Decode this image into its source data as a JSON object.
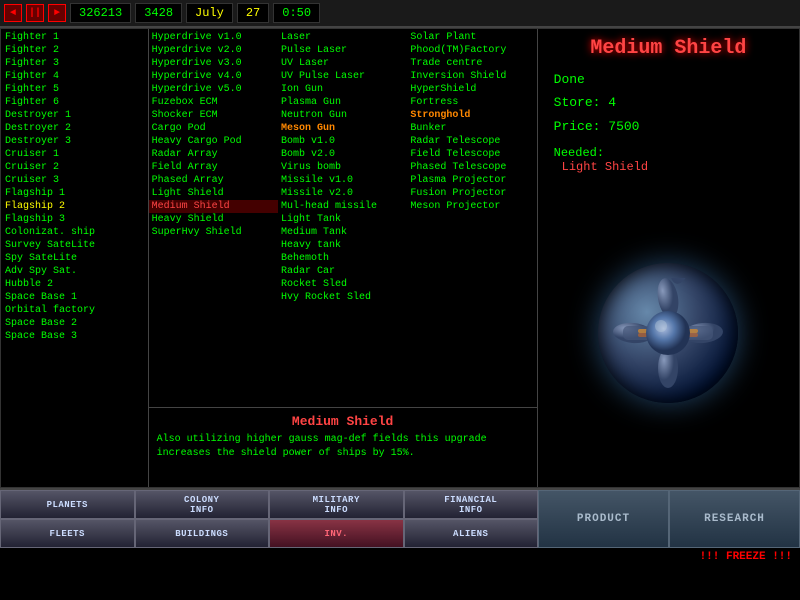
{
  "topbar": {
    "btn1": "◄",
    "btn2": "►",
    "money": "326213",
    "production": "3428",
    "month": "July",
    "day": "27",
    "time": "0:50"
  },
  "ships": [
    {
      "id": 1,
      "name": "Fighter 1"
    },
    {
      "id": 2,
      "name": "Fighter 2"
    },
    {
      "id": 3,
      "name": "Fighter 3"
    },
    {
      "id": 4,
      "name": "Fighter 4"
    },
    {
      "id": 5,
      "name": "Fighter 5"
    },
    {
      "id": 6,
      "name": "Fighter 6"
    },
    {
      "id": 7,
      "name": "Destroyer 1"
    },
    {
      "id": 8,
      "name": "Destroyer 2"
    },
    {
      "id": 9,
      "name": "Destroyer 3"
    },
    {
      "id": 10,
      "name": "Cruiser 1"
    },
    {
      "id": 11,
      "name": "Cruiser 2"
    },
    {
      "id": 12,
      "name": "Cruiser 3"
    },
    {
      "id": 13,
      "name": "Flagship 1"
    },
    {
      "id": 14,
      "name": "Flagship 2"
    },
    {
      "id": 15,
      "name": "Flagship 3"
    },
    {
      "id": 16,
      "name": "Colonizat. ship"
    },
    {
      "id": 17,
      "name": "Survey SateLite"
    },
    {
      "id": 18,
      "name": "Spy SateLite"
    },
    {
      "id": 19,
      "name": "Adv Spy Sat."
    },
    {
      "id": 20,
      "name": "Hubble 2"
    },
    {
      "id": 21,
      "name": "Space Base 1"
    },
    {
      "id": 22,
      "name": "Orbital factory"
    },
    {
      "id": 23,
      "name": "Space Base 2"
    },
    {
      "id": 24,
      "name": "Space Base 3"
    }
  ],
  "tech_col1": [
    {
      "name": "Hyperdrive v1.0",
      "selected": false
    },
    {
      "name": "Hyperdrive v2.0",
      "selected": false
    },
    {
      "name": "Hyperdrive v3.0",
      "selected": false
    },
    {
      "name": "Hyperdrive v4.0",
      "selected": false
    },
    {
      "name": "Hyperdrive v5.0",
      "selected": false
    },
    {
      "name": "Fuzebox ECM",
      "selected": false
    },
    {
      "name": "Shocker ECM",
      "selected": false
    },
    {
      "name": "Cargo Pod",
      "selected": false
    },
    {
      "name": "Heavy Cargo Pod",
      "selected": false
    },
    {
      "name": "Radar Array",
      "selected": false
    },
    {
      "name": "Field Array",
      "selected": false
    },
    {
      "name": "Phased Array",
      "selected": false
    },
    {
      "name": "Light Shield",
      "selected": false
    },
    {
      "name": "Medium Shield",
      "selected": true
    },
    {
      "name": "Heavy Shield",
      "selected": false
    },
    {
      "name": "SuperHvy Shield",
      "selected": false
    }
  ],
  "tech_col2": [
    {
      "name": "Laser",
      "selected": false
    },
    {
      "name": "Pulse Laser",
      "selected": false
    },
    {
      "name": "UV Laser",
      "selected": false
    },
    {
      "name": "UV Pulse Laser",
      "selected": false
    },
    {
      "name": "Ion Gun",
      "selected": false
    },
    {
      "name": "Plasma Gun",
      "selected": false
    },
    {
      "name": "Neutron Gun",
      "selected": false
    },
    {
      "name": "Meson Gun",
      "selected": false,
      "highlight": true
    },
    {
      "name": "Bomb v1.0",
      "selected": false
    },
    {
      "name": "Bomb v2.0",
      "selected": false
    },
    {
      "name": "Virus bomb",
      "selected": false
    },
    {
      "name": "Missile v1.0",
      "selected": false
    },
    {
      "name": "Missile v2.0",
      "selected": false
    },
    {
      "name": "Mul-head missile",
      "selected": false
    },
    {
      "name": "Light Tank",
      "selected": false
    },
    {
      "name": "Medium Tank",
      "selected": false
    },
    {
      "name": "Heavy tank",
      "selected": false
    },
    {
      "name": "Behemoth",
      "selected": false
    },
    {
      "name": "Radar Car",
      "selected": false
    },
    {
      "name": "Rocket Sled",
      "selected": false
    },
    {
      "name": "Hvy Rocket Sled",
      "selected": false
    }
  ],
  "tech_col3": [
    {
      "name": "Solar Plant",
      "selected": false
    },
    {
      "name": "Phood(TM)Factory",
      "selected": false
    },
    {
      "name": "Trade centre",
      "selected": false
    },
    {
      "name": "Inversion Shield",
      "selected": false
    },
    {
      "name": "HyperShield",
      "selected": false
    },
    {
      "name": "Fortress",
      "selected": false
    },
    {
      "name": "Stronghold",
      "selected": false,
      "bold": true
    },
    {
      "name": "Bunker",
      "selected": false
    },
    {
      "name": "Radar Telescope",
      "selected": false
    },
    {
      "name": "Field Telescope",
      "selected": false
    },
    {
      "name": "Phased Telescope",
      "selected": false
    },
    {
      "name": "Plasma Projector",
      "selected": false
    },
    {
      "name": "Fusion Projector",
      "selected": false
    },
    {
      "name": "Meson Projector",
      "selected": false
    }
  ],
  "description": {
    "title": "Medium Shield",
    "text": "Also utilizing higher gauss mag-def fields this upgrade increases the shield power of ships by 15%."
  },
  "right_panel": {
    "title": "Medium Shield",
    "done_label": "Done",
    "store_label": "Store: 4",
    "price_label": "Price: 7500",
    "needed_title": "Needed:",
    "needed_value": "Light Shield"
  },
  "bottom_buttons": {
    "row1": [
      {
        "label": "PLANETS",
        "active": false
      },
      {
        "label": "COLONY\nINFO",
        "active": false
      },
      {
        "label": "MILITARY\nINFO",
        "active": false
      },
      {
        "label": "FINANCIAL\nINFO",
        "active": false
      }
    ],
    "row2": [
      {
        "label": "FLEETS",
        "active": false
      },
      {
        "label": "BUILDINGS",
        "active": false
      },
      {
        "label": "INV.",
        "active": true
      },
      {
        "label": "ALIENS",
        "active": false
      }
    ],
    "actions": [
      {
        "label": "PRODUCT"
      },
      {
        "label": "RESEARCH"
      }
    ]
  },
  "freeze": "!!! FREEZE !!!"
}
